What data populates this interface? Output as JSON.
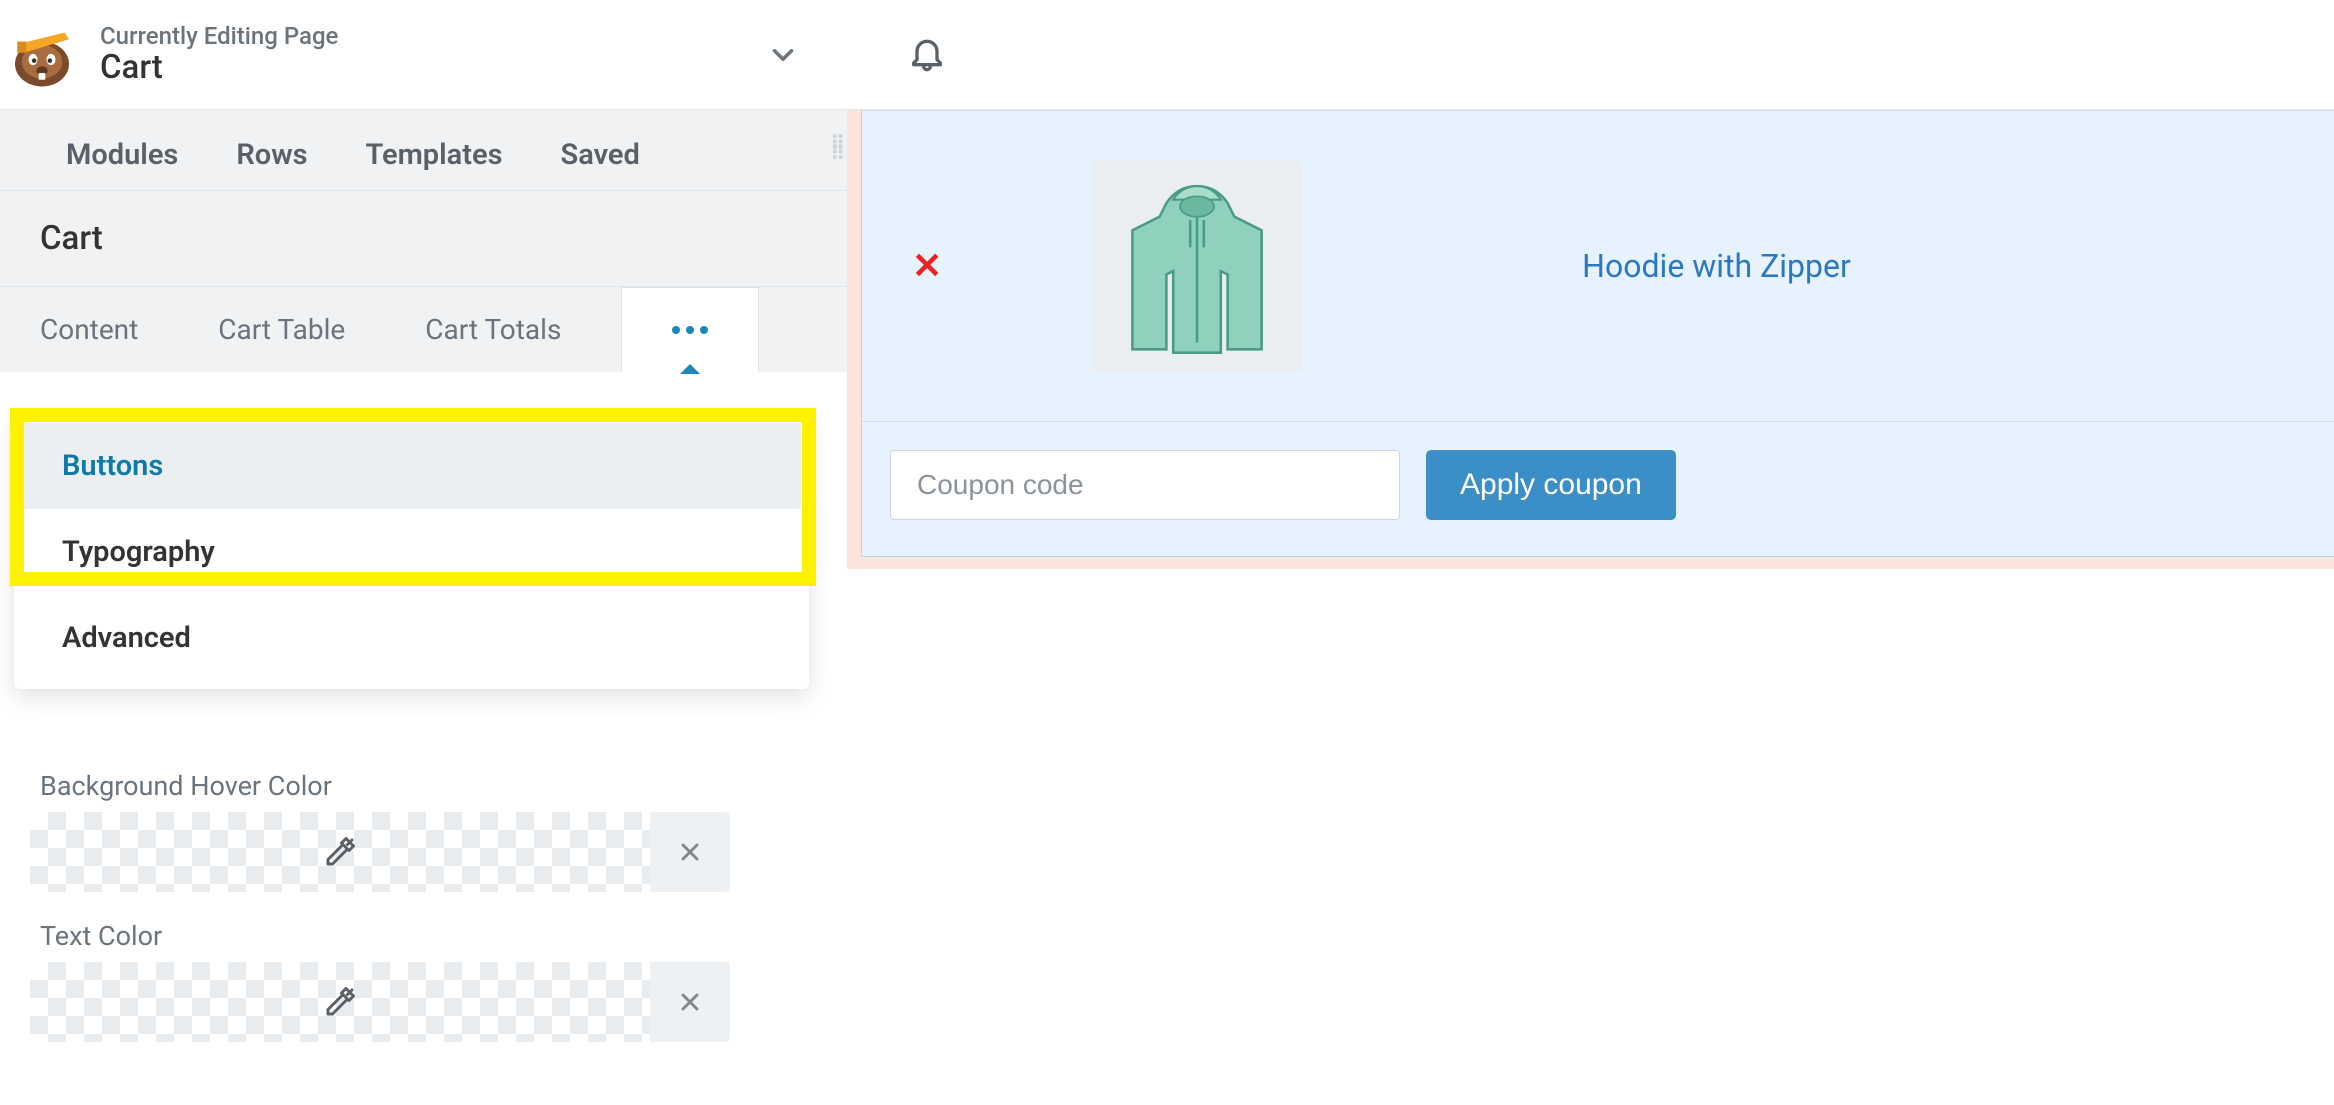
{
  "header": {
    "subtitle": "Currently Editing Page",
    "title": "Cart"
  },
  "main_tabs": {
    "t0": "Modules",
    "t1": "Rows",
    "t2": "Templates",
    "t3": "Saved"
  },
  "section_title": "Cart",
  "sub_tabs": {
    "t0": "Content",
    "t1": "Cart Table",
    "t2": "Cart Totals"
  },
  "dropdown": {
    "i0": "Buttons",
    "i1": "Typography",
    "i2": "Advanced"
  },
  "settings": {
    "bg_hover_label": "Background Hover Color",
    "text_color_label": "Text Color"
  },
  "preview": {
    "product_name": "Hoodie with Zipper",
    "coupon_placeholder": "Coupon code",
    "apply_label": "Apply coupon"
  }
}
